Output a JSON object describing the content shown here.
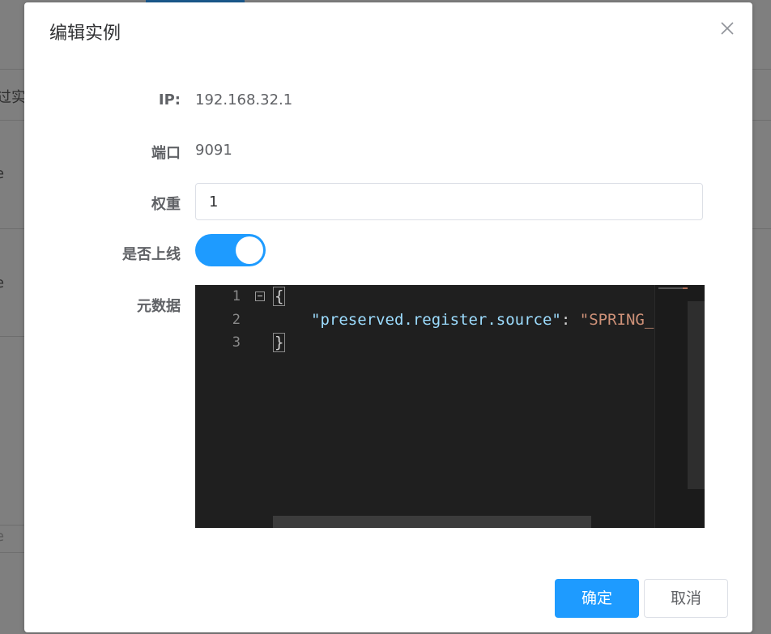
{
  "background": {
    "fragments": [
      "过实",
      "e",
      "e",
      "e"
    ]
  },
  "dialog": {
    "title": "编辑实例",
    "close_icon": "close-icon"
  },
  "form": {
    "ip": {
      "label": "IP:",
      "value": "192.168.32.1"
    },
    "port": {
      "label": "端口",
      "value": "9091"
    },
    "weight": {
      "label": "权重",
      "value": "1"
    },
    "online": {
      "label": "是否上线",
      "enabled": true
    },
    "metadata": {
      "label": "元数据",
      "line_numbers": [
        "1",
        "2",
        "3"
      ],
      "open_brace": "{",
      "key": "\"preserved.register.source\"",
      "colon": ": ",
      "value": "\"SPRING_",
      "close_brace": "}"
    }
  },
  "footer": {
    "confirm_label": "确定",
    "cancel_label": "取消"
  },
  "colors": {
    "primary": "#1e9bff",
    "editor_bg": "#1f1f1f",
    "json_key": "#9cdcfe",
    "json_string": "#ce9178"
  }
}
